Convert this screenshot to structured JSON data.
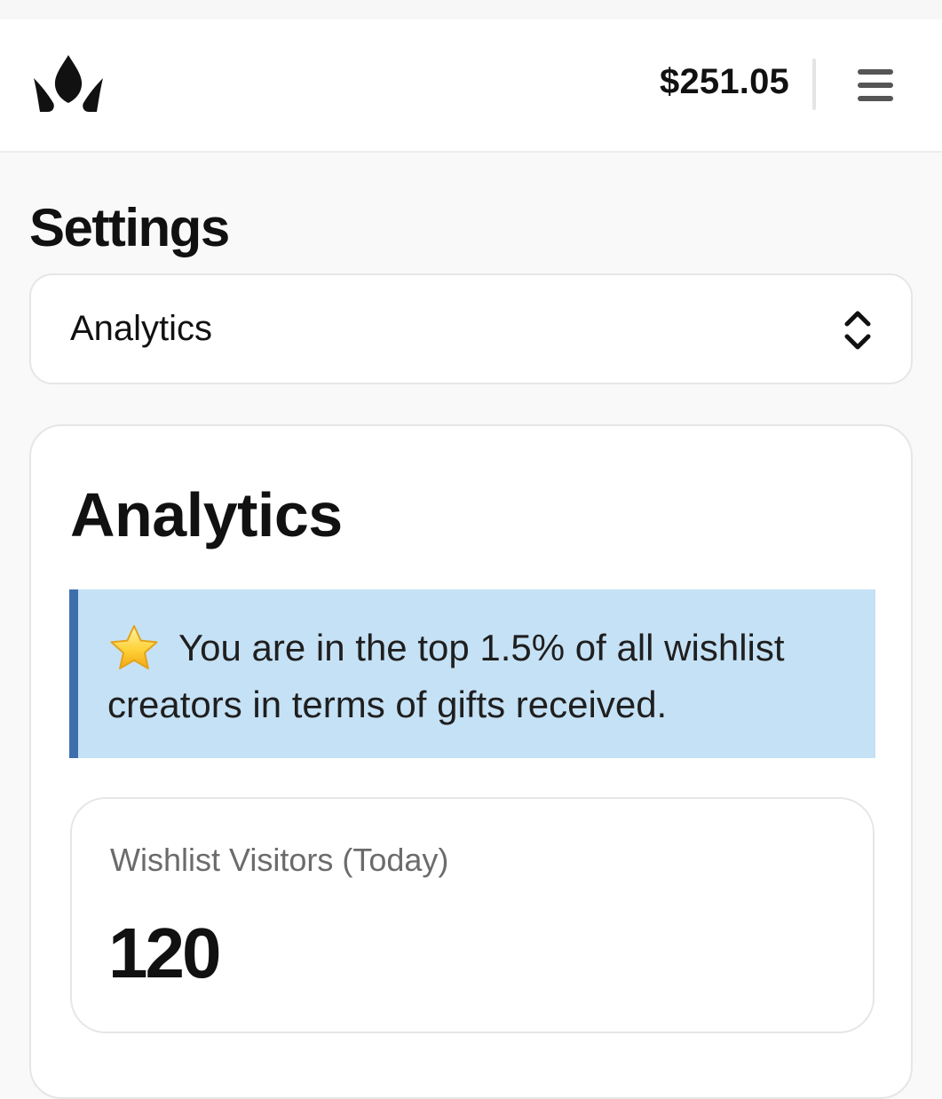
{
  "header": {
    "logo_icon": "crown-logo-icon",
    "balance": "$251.05",
    "menu_icon": "hamburger-menu-icon"
  },
  "page": {
    "title": "Settings"
  },
  "section_select": {
    "value": "Analytics",
    "icon": "chevron-up-down-icon"
  },
  "analytics": {
    "title": "Analytics",
    "banner": {
      "icon": "star-icon",
      "text": "You are in the top 1.5% of all wishlist creators in terms of gifts received."
    },
    "stat": {
      "label": "Wishlist Visitors (Today)",
      "value": "120"
    }
  },
  "colors": {
    "banner_bg": "#c5e1f5",
    "banner_accent": "#3f6eae",
    "page_bg": "#f9f9f9"
  }
}
